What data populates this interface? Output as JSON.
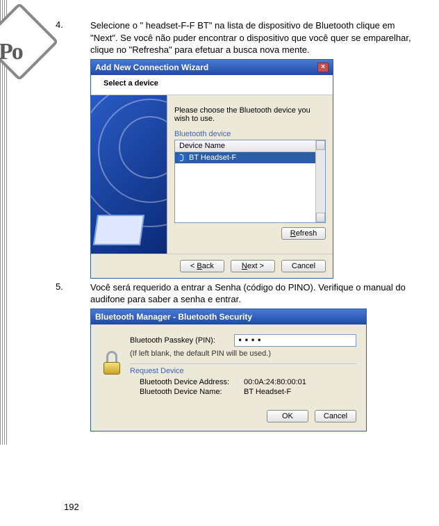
{
  "logo_text": "Po",
  "step4": {
    "num": "4.",
    "text": "Selecione o \" headset-F-F BT\" na lista de dispositivo de Bluetooth clique em \"Next\". Se você não puder encontrar o dispositivo que você quer se emparelhar, clique no \"Refresha\" para efetuar a busca nova mente."
  },
  "dialog1": {
    "title": "Add New Connection Wizard",
    "close_glyph": "×",
    "select_label": "Select a device",
    "instruction": "Please choose the Bluetooth device you wish to use.",
    "group_label": "Bluetooth device",
    "column_header": "Device Name",
    "device_rows": [
      "BT Headset-F"
    ],
    "refresh_label": "Refresh",
    "refresh_u": "R",
    "back_label": "< Back",
    "back_u": "B",
    "next_label": "Next >",
    "next_u": "N",
    "cancel_label": "Cancel"
  },
  "step5": {
    "num": "5.",
    "text": "Você será requerido a entrar a Senha (código do PINO).    Verifique o manual do audifone para saber a senha e entrar."
  },
  "dialog2": {
    "title": "Bluetooth Manager  -  Bluetooth Security",
    "passkey_label": "Bluetooth Passkey (PIN):",
    "passkey_value": "••••",
    "hint": "(If left blank, the default PIN will be used.)",
    "group_label": "Request Device",
    "addr_label": "Bluetooth Device Address:",
    "addr_value": "00:0A:24:80:00:01",
    "name_label": "Bluetooth Device Name:",
    "name_value": "BT Headset-F",
    "ok_label": "OK",
    "cancel_label": "Cancel"
  },
  "page_number": "192"
}
